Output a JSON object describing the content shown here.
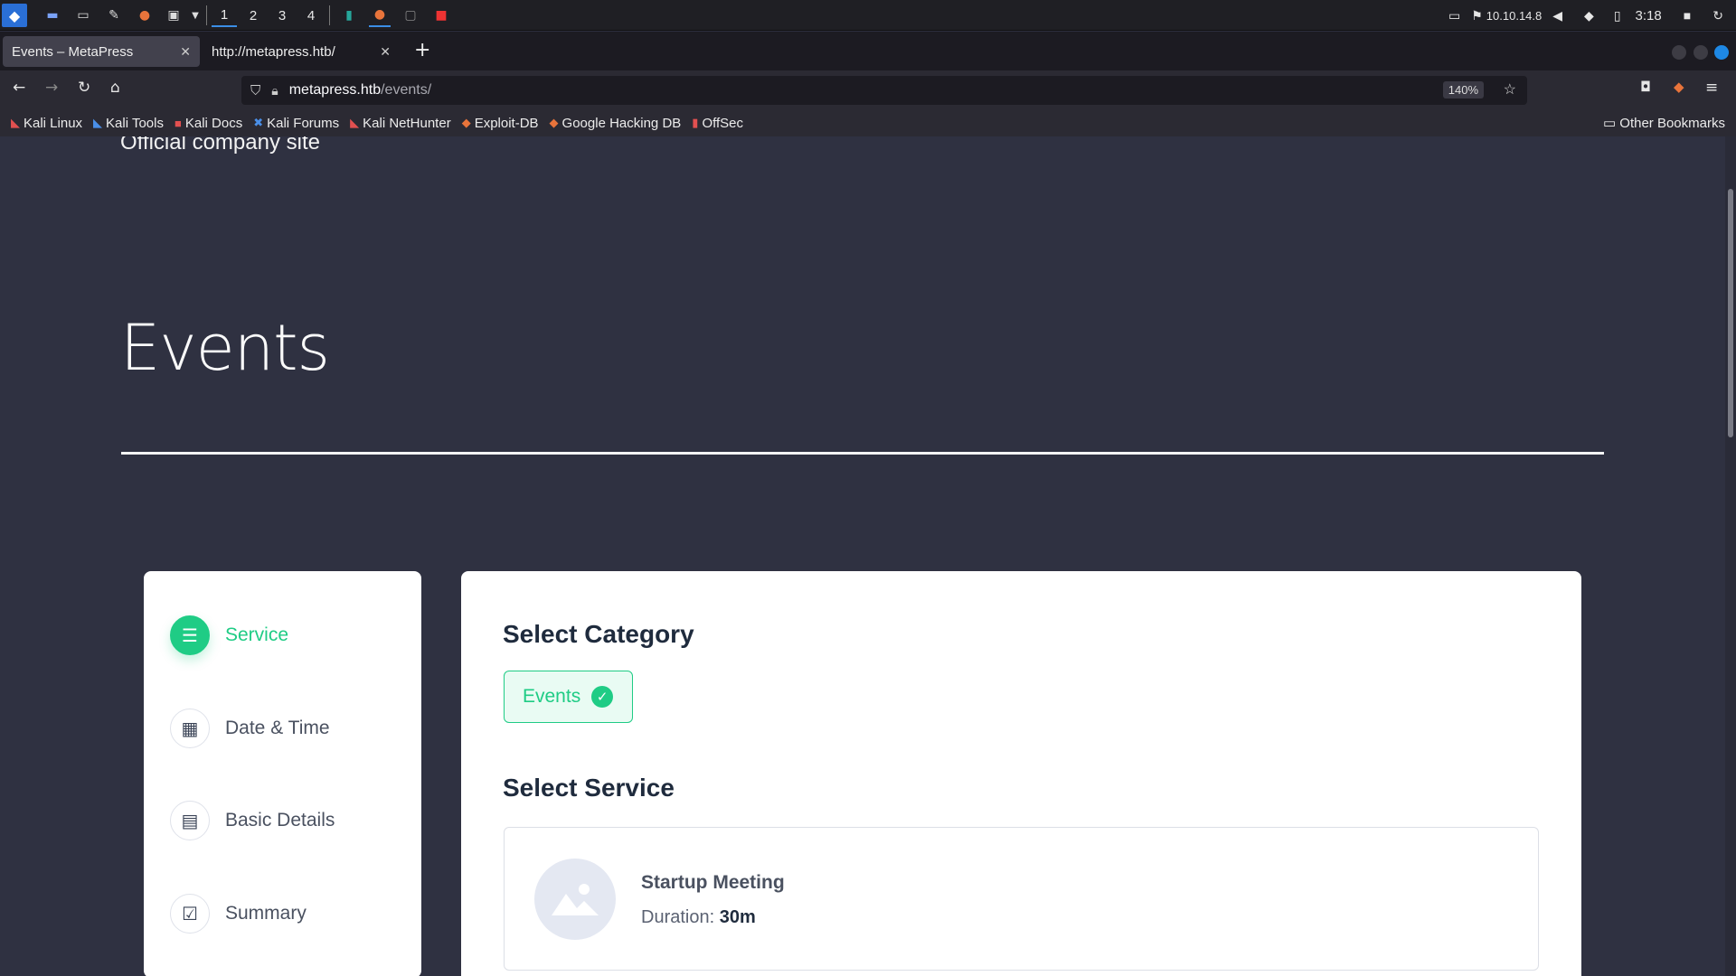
{
  "taskbar": {
    "workspaces": [
      "1",
      "2",
      "3",
      "4"
    ],
    "ip": "10.10.14.8",
    "time": "3:18"
  },
  "tabs": [
    {
      "title": "Events – MetaPress",
      "selected": true
    },
    {
      "title": "http://metapress.htb/",
      "selected": false
    }
  ],
  "url": {
    "host": "metapress.htb",
    "path": "/events/",
    "zoom": "140%"
  },
  "bookmarks": [
    "Kali Linux",
    "Kali Tools",
    "Kali Docs",
    "Kali Forums",
    "Kali NetHunter",
    "Exploit-DB",
    "Google Hacking DB",
    "OffSec"
  ],
  "other_bookmarks": "Other Bookmarks",
  "page": {
    "tagline": "Official company site",
    "title": "Events"
  },
  "steps": [
    {
      "label": "Service",
      "icon": "service-icon",
      "active": true
    },
    {
      "label": "Date & Time",
      "icon": "calendar-icon",
      "active": false
    },
    {
      "label": "Basic Details",
      "icon": "document-icon",
      "active": false
    },
    {
      "label": "Summary",
      "icon": "checklist-icon",
      "active": false
    }
  ],
  "booking": {
    "category_heading": "Select Category",
    "category": "Events",
    "service_heading": "Select Service",
    "service_name": "Startup Meeting",
    "duration_label": "Duration:",
    "duration_value": "30m"
  },
  "colors": {
    "accent": "#1fcc85",
    "page_bg": "#2f3141",
    "heading": "#1f2b3d"
  }
}
